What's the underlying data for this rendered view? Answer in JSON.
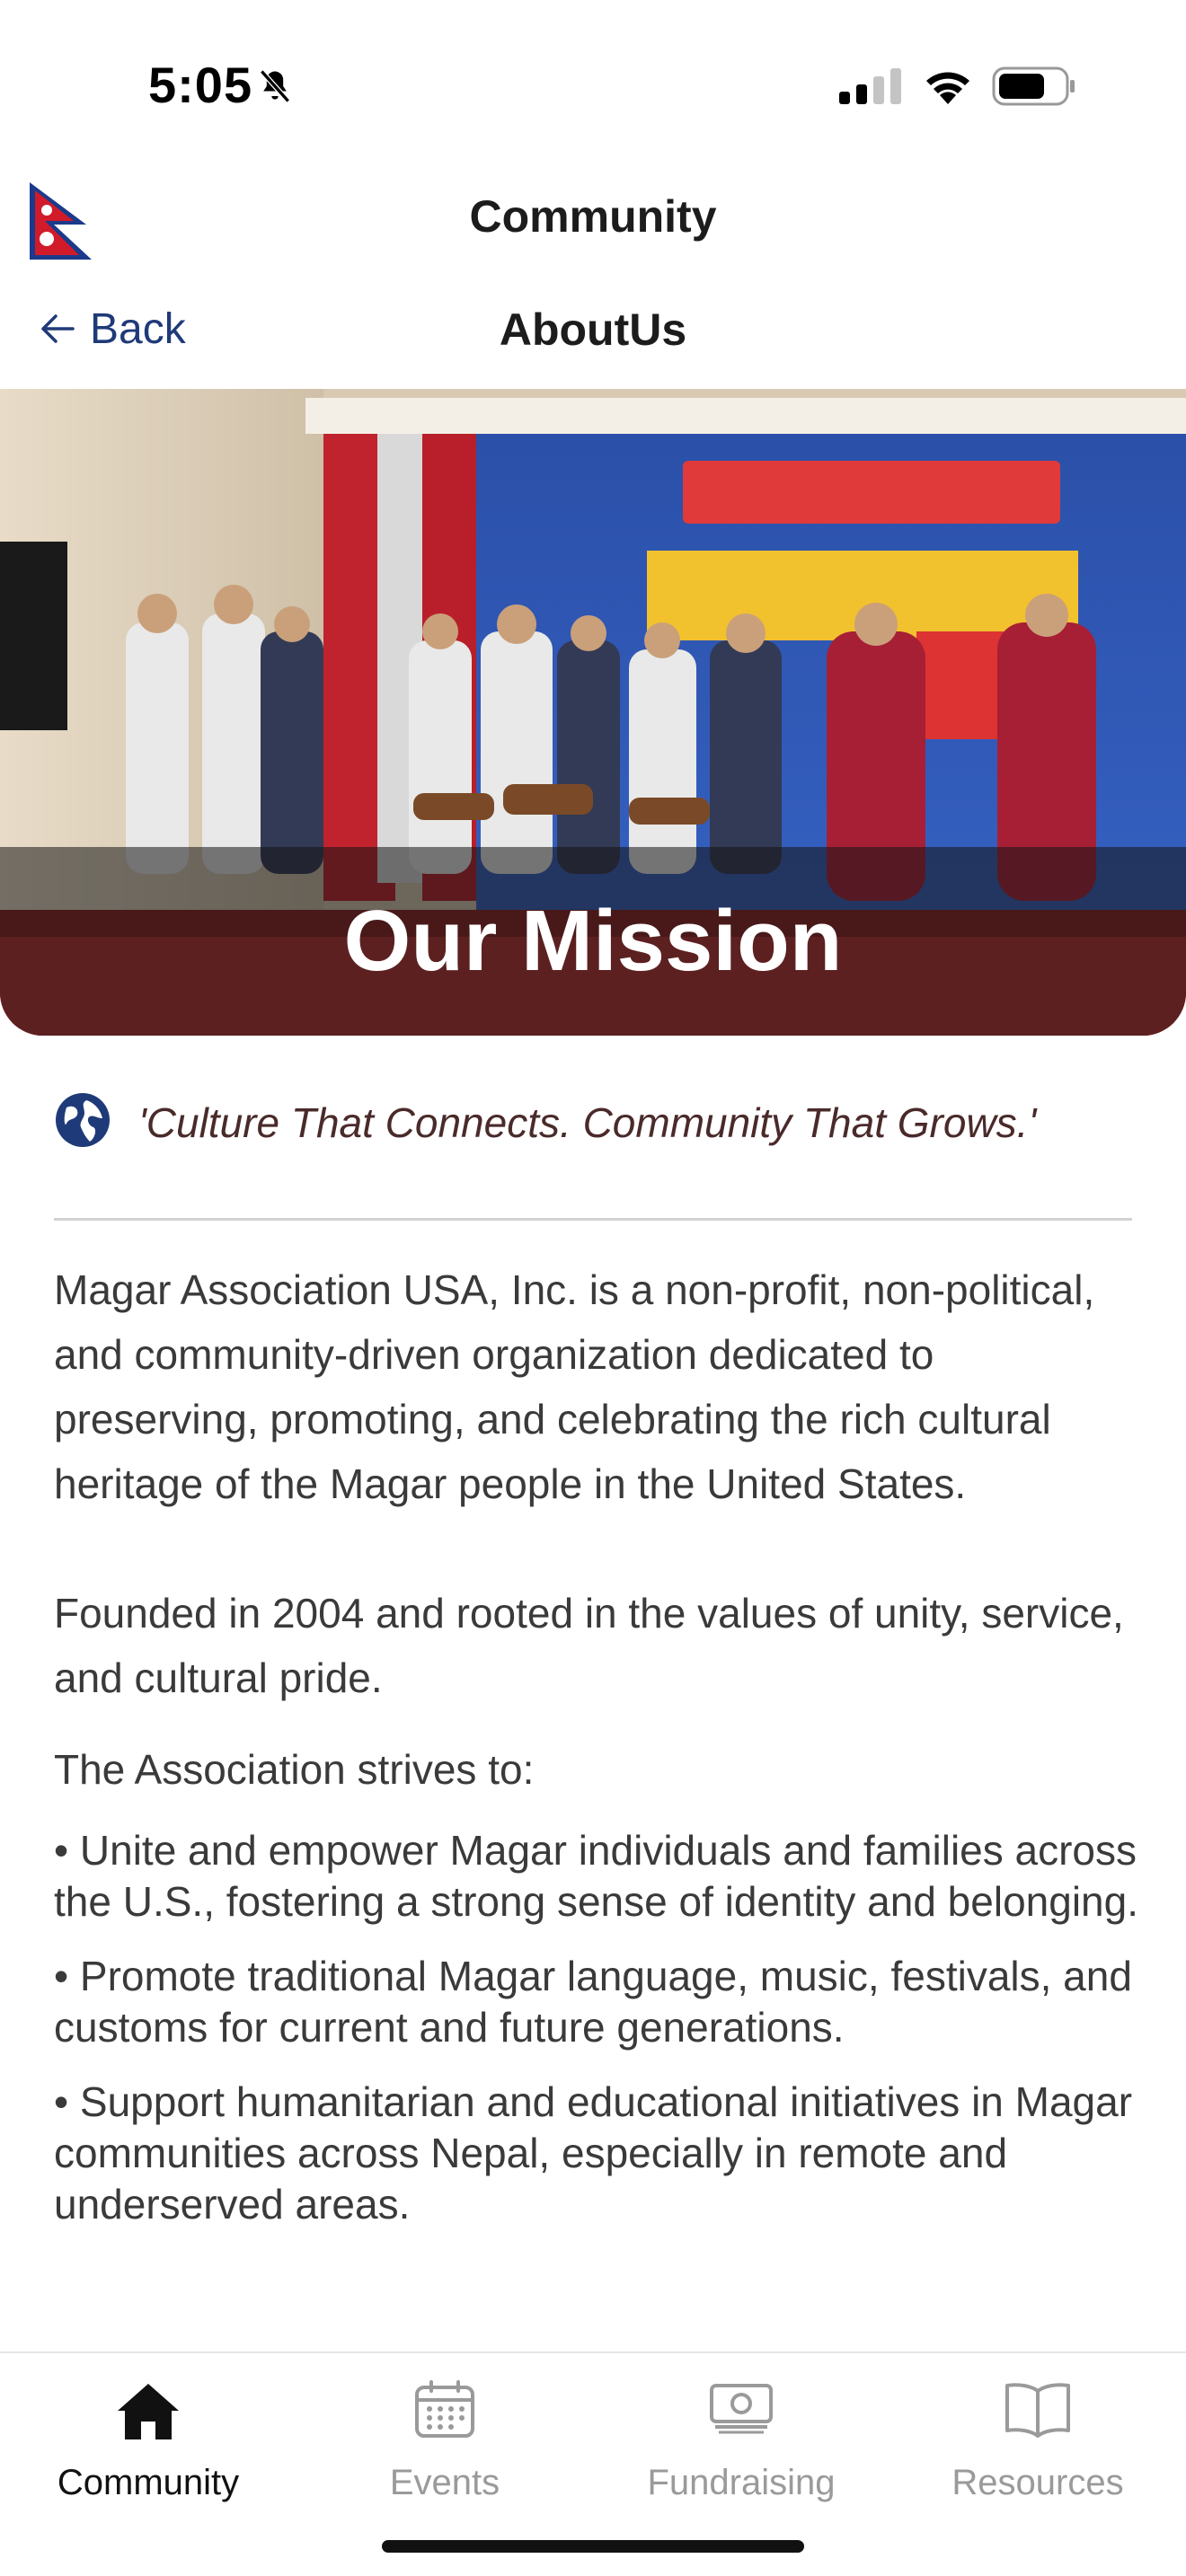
{
  "status_bar": {
    "time": "5:05",
    "bell_icon": "bell-slash-icon",
    "signal_icon": "cellular-signal-icon",
    "wifi_icon": "wifi-icon",
    "battery_icon": "battery-icon"
  },
  "header": {
    "flag_icon": "nepal-flag-icon",
    "app_title": "Community",
    "back_label": "Back",
    "page_title": "AboutUs"
  },
  "hero": {
    "title": "Our Mission",
    "image": "community-cultural-performance-photo"
  },
  "motto": {
    "icon": "globe-icon",
    "text": "'Culture That Connects. Community That Grows.'"
  },
  "content": {
    "intro": "Magar Association USA, Inc. is a non-profit, non-political, and community-driven organization dedicated to preserving, promoting, and celebrating the rich cultural heritage of the Magar people in the United States.",
    "founded": "Founded in 2004 and rooted in the values of unity, service, and cultural pride.",
    "strives_heading": "The Association strives to:",
    "bullets": [
      "• Unite and empower Magar individuals and families across the U.S., fostering a strong sense of identity and belonging.",
      "• Promote traditional Magar language, music, festivals, and customs for current and future generations.",
      "• Support humanitarian and educational initiatives in Magar communities across Nepal, especially in remote and underserved areas."
    ]
  },
  "tab_bar": {
    "tabs": [
      {
        "label": "Community",
        "icon": "home-icon",
        "active": true
      },
      {
        "label": "Events",
        "icon": "calendar-icon",
        "active": false
      },
      {
        "label": "Fundraising",
        "icon": "money-icon",
        "active": false
      },
      {
        "label": "Resources",
        "icon": "book-icon",
        "active": false
      }
    ]
  },
  "colors": {
    "accent": "#1f3a78",
    "active_tab": "#111111",
    "inactive_tab": "#9a9a9a",
    "text": "#3a3a3a",
    "motto_text": "#4a2a2a"
  }
}
